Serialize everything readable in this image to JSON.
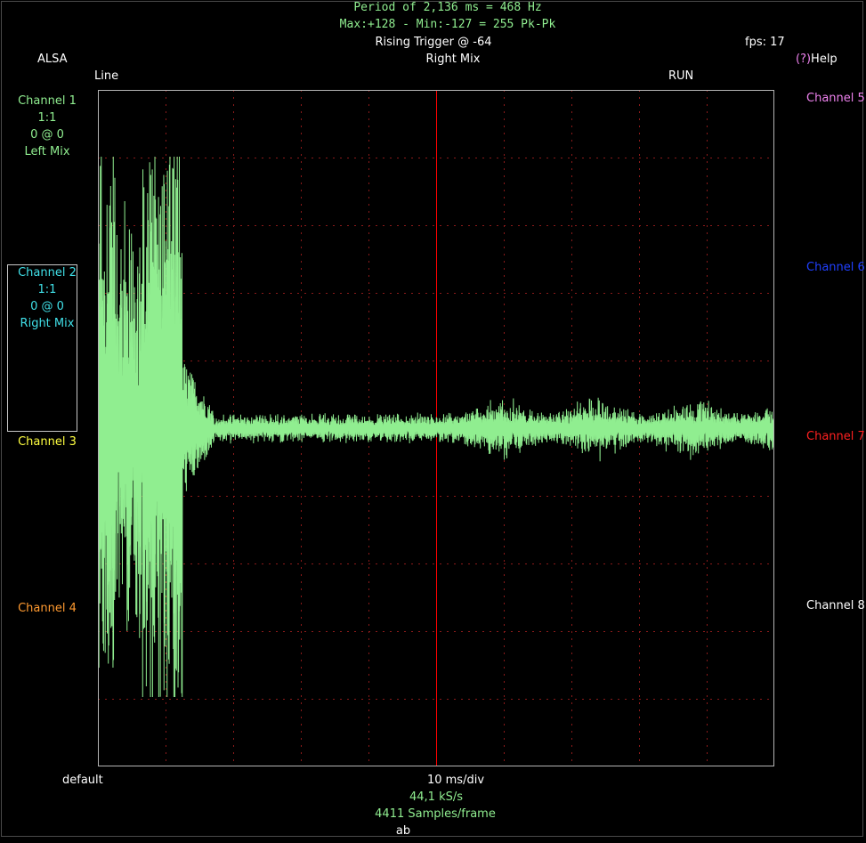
{
  "header": {
    "period_line": "Period of 2,136 ms =   468 Hz",
    "minmax_line": "Max:+128 - Min:-127 = 255 Pk-Pk",
    "trigger": "Rising Trigger @ -64",
    "fps": "fps: 17",
    "source": "ALSA",
    "trigger_channel": "Right Mix",
    "help_prefix": "(?)",
    "help_label": "Help",
    "input": "Line",
    "run_state": "RUN"
  },
  "channels_left": [
    {
      "name": "Channel 1",
      "scale": "1:1",
      "offset": "0 @ 0",
      "source": "Left Mix",
      "color": "#90ee90"
    },
    {
      "name": "Channel 2",
      "scale": "1:1",
      "offset": "0 @ 0",
      "source": "Right Mix",
      "color": "#40e0e8",
      "selected": true
    },
    {
      "name": "Channel 3",
      "color": "#ffff40"
    },
    {
      "name": "Channel 4",
      "color": "#ff9a30"
    }
  ],
  "channels_right": [
    {
      "name": "Channel 5",
      "color": "#ee82ee"
    },
    {
      "name": "Channel 6",
      "color": "#2040ff"
    },
    {
      "name": "Channel 7",
      "color": "#ff2020"
    },
    {
      "name": "Channel 8",
      "color": "#ffffff"
    }
  ],
  "footer": {
    "preset": "default",
    "timebase": "10 ms/div",
    "sample_rate": "44,1 kS/s",
    "samples_per_frame": "4411 Samples/frame",
    "mode": "ab"
  },
  "colors": {
    "background": "#000000",
    "trace": "#90ee90",
    "grid": "#8b1a1a",
    "trigger_line": "#ff0000",
    "screen_border": "#b4b4b4"
  }
}
